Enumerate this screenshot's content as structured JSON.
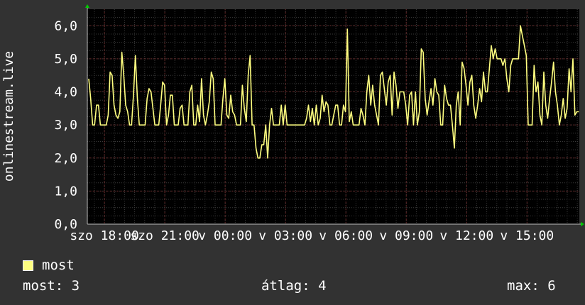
{
  "chart_data": {
    "type": "line",
    "ylabel": "onlinestream.live",
    "ylim": [
      0,
      6.5
    ],
    "y_ticks": [
      "0,0",
      "1,0",
      "2,0",
      "3,0",
      "4,0",
      "5,0",
      "6,0"
    ],
    "x_ticks": [
      "szo 18:00",
      "szo 21:00",
      "v 00:00",
      "v 03:00",
      "v 06:00",
      "v 09:00",
      "v 12:00",
      "v 15:00"
    ],
    "x_hours": [
      0,
      3,
      6,
      9,
      12,
      15,
      18,
      21
    ],
    "x_range_hours": [
      -0.85,
      23.6
    ],
    "series": [
      {
        "name": "most",
        "color": "#ffff80",
        "values": [
          4.4,
          3.8,
          3.0,
          3.0,
          3.6,
          3.6,
          3.0,
          3.0,
          3.0,
          3.0,
          3.3,
          4.6,
          4.5,
          3.6,
          3.3,
          3.2,
          3.4,
          5.2,
          4.5,
          3.6,
          3.4,
          3.0,
          3.0,
          3.9,
          5.1,
          3.8,
          3.0,
          3.0,
          3.0,
          3.0,
          3.8,
          4.1,
          4.0,
          3.5,
          3.0,
          3.0,
          3.0,
          3.6,
          4.3,
          4.2,
          3.0,
          3.3,
          3.9,
          3.9,
          3.0,
          3.0,
          3.0,
          3.5,
          3.6,
          3.0,
          3.0,
          3.0,
          4.0,
          4.2,
          3.0,
          3.0,
          3.6,
          3.1,
          4.4,
          3.3,
          3.0,
          3.3,
          3.7,
          4.6,
          4.4,
          3.0,
          3.0,
          3.0,
          3.0,
          3.8,
          4.4,
          3.3,
          3.2,
          3.9,
          3.4,
          3.3,
          3.0,
          3.0,
          3.0,
          4.2,
          3.5,
          3.1,
          4.5,
          5.1,
          3.0,
          3.0,
          2.3,
          2.0,
          2.0,
          2.4,
          2.4,
          3.0,
          2.0,
          3.0,
          3.5,
          3.0,
          3.0,
          3.0,
          3.0,
          3.6,
          3.0,
          3.6,
          3.0,
          3.0,
          3.0,
          3.0,
          3.0,
          3.0,
          3.0,
          3.0,
          3.0,
          3.0,
          3.2,
          3.6,
          3.1,
          3.5,
          3.0,
          3.6,
          3.0,
          3.2,
          3.9,
          3.4,
          3.7,
          3.6,
          3.0,
          3.0,
          3.3,
          3.6,
          3.6,
          3.0,
          3.0,
          3.6,
          3.4,
          5.9,
          3.1,
          3.4,
          3.0,
          3.0,
          3.0,
          3.0,
          3.5,
          3.3,
          3.0,
          4.0,
          4.5,
          3.6,
          4.2,
          3.6,
          3.3,
          3.0,
          4.5,
          4.6,
          4.1,
          3.6,
          4.3,
          4.5,
          3.3,
          4.6,
          4.2,
          3.5,
          4.0,
          4.0,
          4.0,
          3.6,
          3.0,
          3.9,
          4.0,
          3.0,
          4.0,
          3.0,
          3.4,
          5.3,
          5.2,
          3.8,
          3.3,
          3.7,
          4.1,
          3.6,
          4.4,
          4.0,
          3.9,
          3.0,
          3.0,
          4.2,
          3.8,
          3.6,
          3.6,
          3.0,
          2.3,
          3.6,
          4.0,
          3.0,
          4.9,
          4.7,
          4.2,
          3.6,
          4.3,
          4.5,
          3.6,
          3.2,
          3.6,
          4.1,
          3.7,
          4.6,
          4.0,
          4.0,
          4.7,
          5.4,
          5.0,
          5.3,
          5.0,
          5.0,
          5.0,
          4.8,
          5.0,
          4.4,
          4.0,
          4.8,
          5.0,
          5.0,
          5.0,
          5.0,
          6.0,
          5.7,
          5.4,
          5.1,
          3.0,
          3.0,
          3.0,
          4.8,
          4.0,
          4.3,
          3.3,
          3.0,
          4.6,
          3.6,
          3.2,
          3.8,
          4.3,
          4.9,
          4.0,
          3.6,
          3.0,
          3.3,
          3.8,
          3.2,
          3.5,
          4.7,
          4.0,
          5.0,
          3.3,
          3.4,
          3.4
        ]
      }
    ],
    "grid": true
  },
  "legend": {
    "label": "most",
    "color": "#ffff80"
  },
  "stats": {
    "current": "most: 3",
    "average": "átlag: 4",
    "max": "max: 6"
  }
}
